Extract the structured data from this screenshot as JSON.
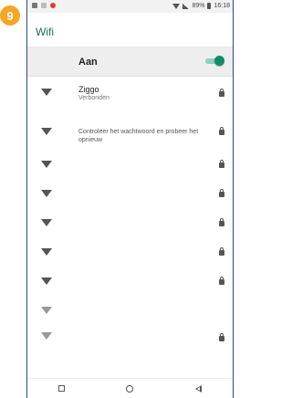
{
  "step_badge": "9",
  "status_bar": {
    "battery_text": "89%",
    "time": "16:18"
  },
  "app_bar": {
    "title": "Wifi"
  },
  "wifi_toggle": {
    "label": "Aan",
    "state": "on"
  },
  "networks": [
    {
      "name": "Ziggo",
      "status": "Verbonden",
      "locked": true
    },
    {
      "name": "",
      "status": "Controleer het wachtwoord en probeer het opnieuw",
      "locked": true
    },
    {
      "name": "",
      "status": "",
      "locked": true
    },
    {
      "name": "",
      "status": "",
      "locked": true
    },
    {
      "name": "",
      "status": "",
      "locked": true
    },
    {
      "name": "",
      "status": "",
      "locked": true
    },
    {
      "name": "",
      "status": "",
      "locked": true
    },
    {
      "name": "",
      "status": "",
      "locked": false
    },
    {
      "name": "",
      "status": "",
      "locked": true
    }
  ],
  "colors": {
    "accent": "#0b8f6b",
    "title": "#1f6f5a",
    "badge": "#f5a623",
    "frame": "#2b4a86"
  }
}
